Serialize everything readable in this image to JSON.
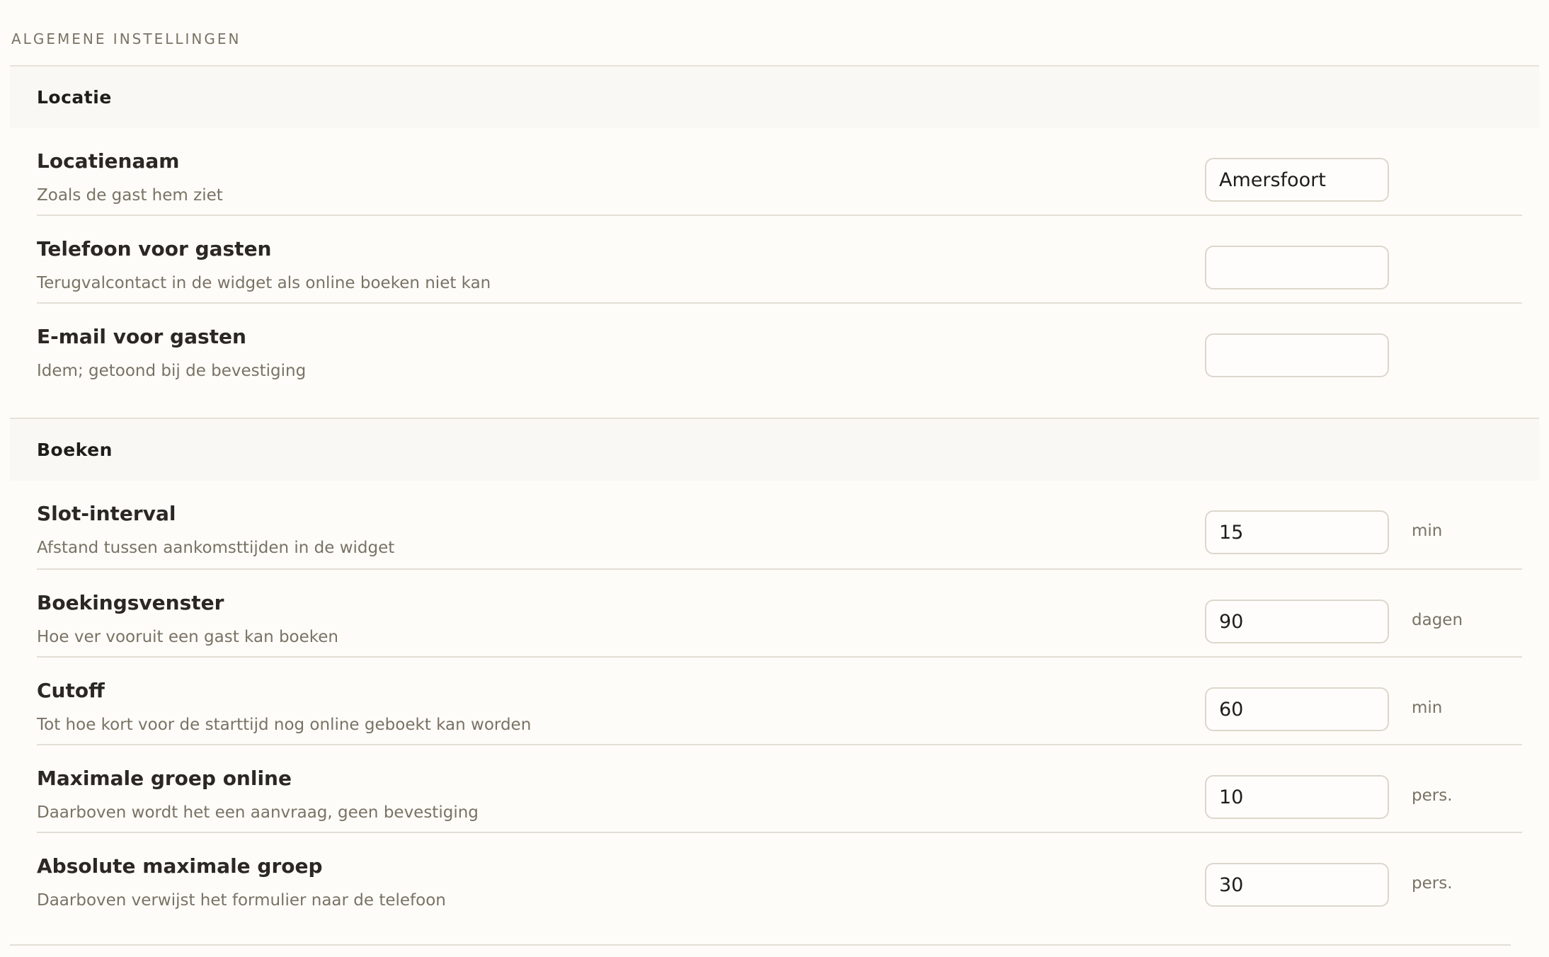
{
  "page": {
    "heading": "ALGEMENE INSTELLINGEN"
  },
  "sections": [
    {
      "title": "Locatie",
      "rows": [
        {
          "label": "Locatienaam",
          "description": "Zoals de gast hem ziet",
          "value": "Amersfoort",
          "unit": ""
        },
        {
          "label": "Telefoon voor gasten",
          "description": "Terugvalcontact in de widget als online boeken niet kan",
          "value": "",
          "unit": ""
        },
        {
          "label": "E-mail voor gasten",
          "description": "Idem; getoond bij de bevestiging",
          "value": "",
          "unit": ""
        }
      ]
    },
    {
      "title": "Boeken",
      "rows": [
        {
          "label": "Slot-interval",
          "description": "Afstand tussen aankomsttijden in de widget",
          "value": "15",
          "unit": "min"
        },
        {
          "label": "Boekingsvenster",
          "description": "Hoe ver vooruit een gast kan boeken",
          "value": "90",
          "unit": "dagen"
        },
        {
          "label": "Cutoff",
          "description": "Tot hoe kort voor de starttijd nog online geboekt kan worden",
          "value": "60",
          "unit": "min"
        },
        {
          "label": "Maximale groep online",
          "description": "Daarboven wordt het een aanvraag, geen bevestiging",
          "value": "10",
          "unit": "pers."
        },
        {
          "label": "Absolute maximale groep",
          "description": "Daarboven verwijst het formulier naar de telefoon",
          "value": "30",
          "unit": "pers."
        }
      ]
    }
  ]
}
